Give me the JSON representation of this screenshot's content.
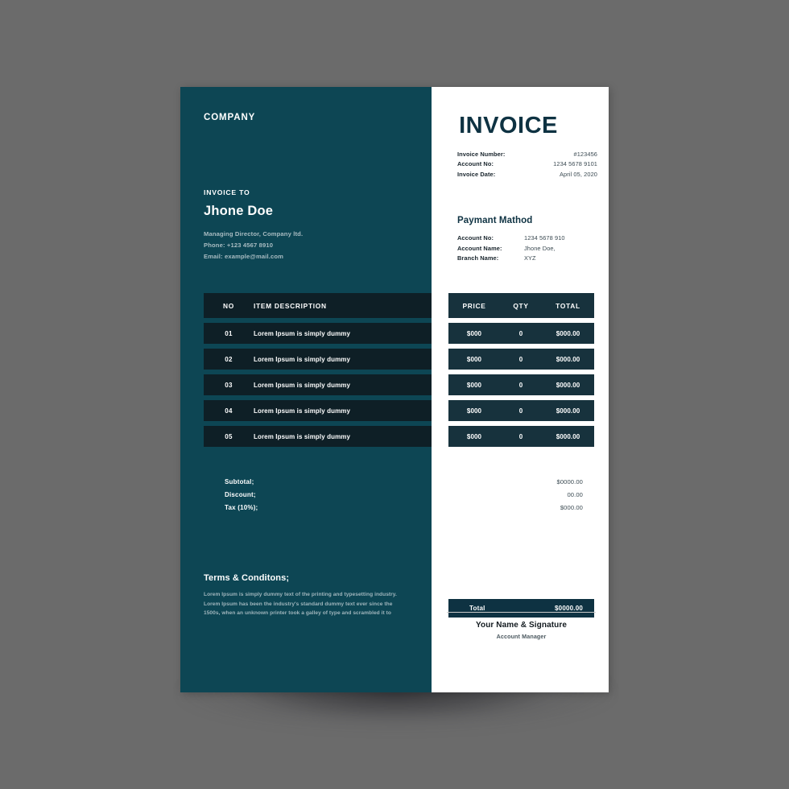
{
  "page": {
    "background_color": "#6b6b6b",
    "sheet_left_color": "#0d4654",
    "sheet_right_color": "#ffffff",
    "accent_dark": "#0e1f26",
    "accent_navy": "#17323d",
    "total_bar_color": "#0e3242"
  },
  "left": {
    "company_logo": "COMPANY",
    "invoice_to_label": "INVOICE TO",
    "client_name": "Jhone Doe",
    "client_role": "Managing Director, Company ltd.",
    "client_phone": "Phone: +123 4567 8910",
    "client_email": "Email: example@mail.com",
    "terms_title": "Terms & Conditons;",
    "terms_line_1": "Lorem Ipsum is simply dummy text of the printing and typesetting industry.",
    "terms_line_2": "Lorem Ipsum has been the industry's standard dummy text ever since the",
    "terms_line_3": "1500s, when an unknown printer took a galley of type and scrambled it to"
  },
  "items_table": {
    "headers": {
      "no": "NO",
      "description": "ITEM DESCRIPTION"
    },
    "rows": [
      {
        "no": "01",
        "description": "Lorem Ipsum is simply dummy"
      },
      {
        "no": "02",
        "description": "Lorem Ipsum is simply dummy"
      },
      {
        "no": "03",
        "description": "Lorem Ipsum is simply dummy"
      },
      {
        "no": "04",
        "description": "Lorem Ipsum is simply dummy"
      },
      {
        "no": "05",
        "description": "Lorem Ipsum is simply dummy"
      }
    ]
  },
  "price_table": {
    "headers": {
      "price": "PRICE",
      "qty": "QTY",
      "total": "TOTAL"
    },
    "rows": [
      {
        "price": "$000",
        "qty": "0",
        "total": "$000.00"
      },
      {
        "price": "$000",
        "qty": "0",
        "total": "$000.00"
      },
      {
        "price": "$000",
        "qty": "0",
        "total": "$000.00"
      },
      {
        "price": "$000",
        "qty": "0",
        "total": "$000.00"
      },
      {
        "price": "$000",
        "qty": "0",
        "total": "$000.00"
      }
    ]
  },
  "totals": {
    "subtotal_label": "Subtotal;",
    "discount_label": "Discount;",
    "tax_label": "Tax (10%);",
    "subtotal_value": "$0000.00",
    "discount_value": "00.00",
    "tax_value": "$000.00",
    "total_label": "Total",
    "total_value": "$0000.00"
  },
  "right": {
    "title": "INVOICE",
    "meta": [
      {
        "label": "Invoice Number:",
        "value": "#123456"
      },
      {
        "label": "Account No:",
        "value": "1234 5678 9101"
      },
      {
        "label": "Invoice Date:",
        "value": "April 05, 2020"
      }
    ],
    "payment_title": "Paymant Mathod",
    "payment": [
      {
        "label": "Account No:",
        "value": "1234 5678 910"
      },
      {
        "label": "Account Name:",
        "value": "Jhone Doe,"
      },
      {
        "label": "Branch Name:",
        "value": "XYZ"
      }
    ],
    "signature_name": "Your Name & Signature",
    "signature_role": "Account Manager"
  }
}
